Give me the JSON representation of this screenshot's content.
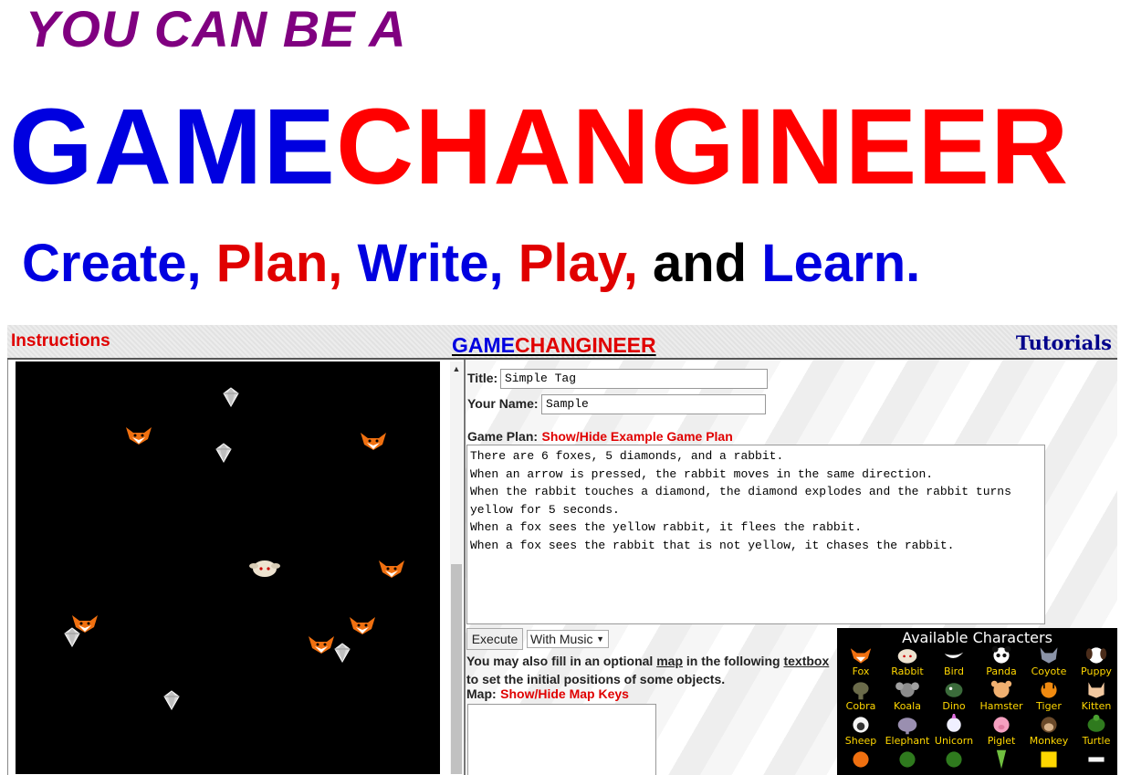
{
  "banner": {
    "top": "YOU CAN BE A",
    "game": "GAME",
    "changineer": "CHANGINEER",
    "sub": [
      {
        "text": "Create,",
        "color": "#0000e0"
      },
      {
        "text": "Plan,",
        "color": "#e00000"
      },
      {
        "text": "Write,",
        "color": "#0000e0"
      },
      {
        "text": "Play,",
        "color": "#e00000"
      },
      {
        "text": "and",
        "color": "#000000"
      },
      {
        "text": "Learn.",
        "color": "#0000e0"
      }
    ]
  },
  "topbar": {
    "instructions": "Instructions",
    "title_game": "GAME",
    "title_changineer": "CHANGINEER",
    "tutorials": "Tutorials"
  },
  "form": {
    "title_label": "Title:",
    "title_value": "Simple Tag",
    "name_label": "Your Name:",
    "name_value": "Sample",
    "plan_label": "Game Plan:",
    "plan_toggle": "Show/Hide Example Game Plan",
    "plan_text": "There are 6 foxes, 5 diamonds, and a rabbit.\nWhen an arrow is pressed, the rabbit moves in the same direction.\nWhen the rabbit touches a diamond, the diamond explodes and the rabbit turns\nyellow for 5 seconds.\nWhen a fox sees the yellow rabbit, it flees the rabbit.\nWhen a fox sees the rabbit that is not yellow, it chases the rabbit.",
    "execute": "Execute",
    "music": "With Music",
    "map_note_1": "You may also fill in an optional",
    "map_word": "map",
    "map_note_2": "in the following",
    "textbox_word": "textbox",
    "map_note_3": "to set the initial positions of some objects.",
    "map_label": "Map:",
    "map_toggle": "Show/Hide Map Keys"
  },
  "characters": {
    "heading": "Available Characters",
    "row1": [
      "Fox",
      "Rabbit",
      "Bird",
      "Panda",
      "Coyote",
      "Puppy"
    ],
    "row2": [
      "Cobra",
      "Koala",
      "Dino",
      "Hamster",
      "Tiger",
      "Kitten"
    ],
    "row3": [
      "Sheep",
      "Elephant",
      "Unicorn",
      "Piglet",
      "Monkey",
      "Turtle"
    ]
  },
  "colors": {
    "blue": "#0000e0",
    "red": "#e00000",
    "purple": "#800080",
    "fox": "#f07010",
    "diamond": "#d8d8d8"
  }
}
